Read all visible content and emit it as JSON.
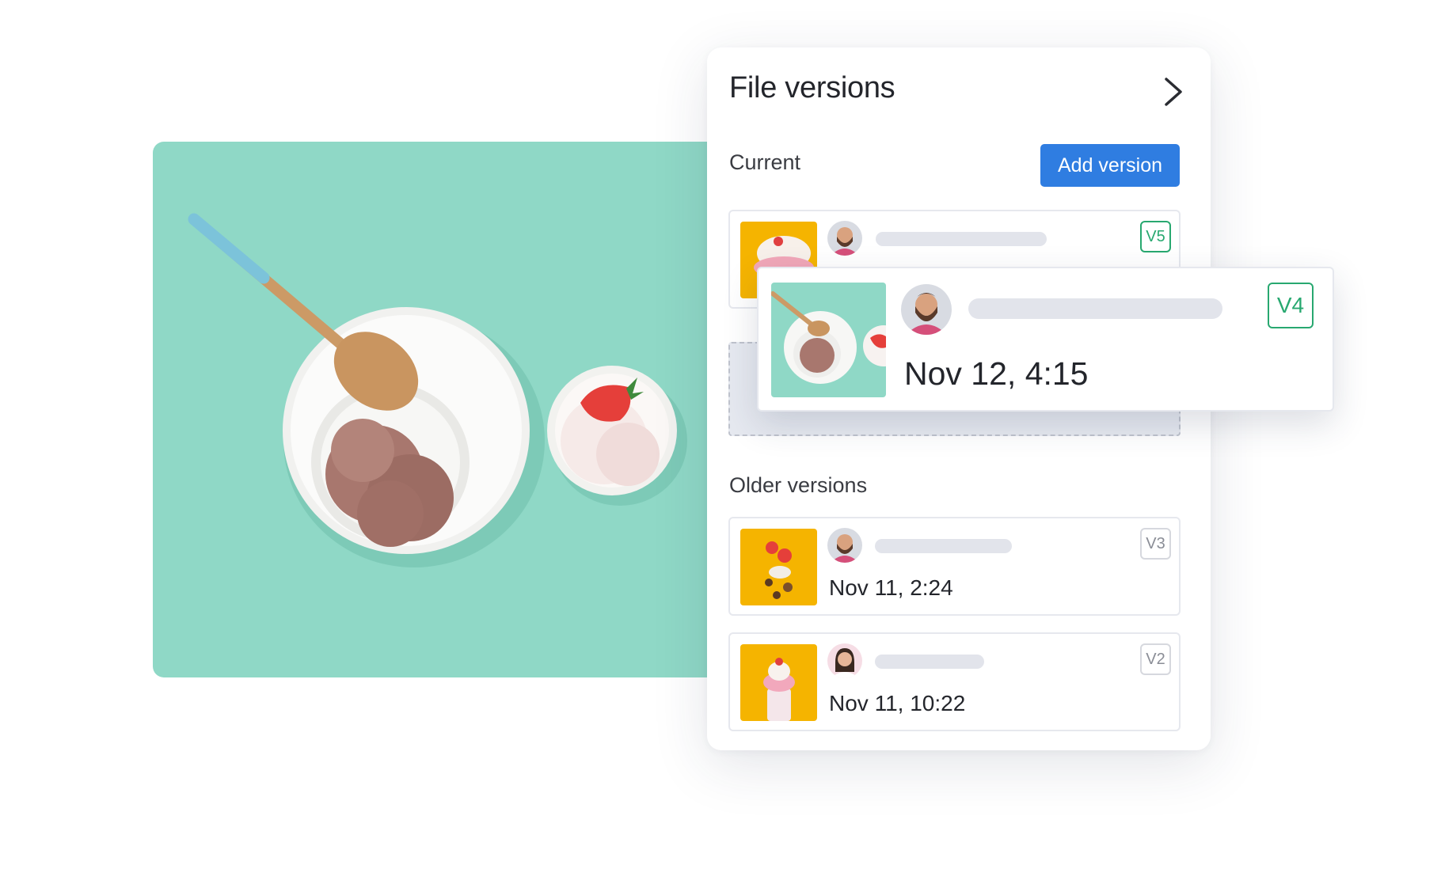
{
  "panel": {
    "title": "File versions",
    "current_label": "Current",
    "add_version_label": "Add version",
    "older_label": "Older versions"
  },
  "current_version": {
    "badge": "V5"
  },
  "dragged_version": {
    "badge": "V4",
    "date": "Nov 12, 4:15"
  },
  "older_versions": [
    {
      "badge": "V3",
      "date": "Nov 11, 2:24"
    },
    {
      "badge": "V2",
      "date": "Nov 11, 10:22"
    }
  ],
  "colors": {
    "accent": "#2f7de1",
    "current_badge": "#28a870",
    "photo_background": "#8fd8c6",
    "thumbnail_yellow": "#f5b400"
  },
  "icons": {
    "panel_collapse": "chevron-right-icon"
  }
}
